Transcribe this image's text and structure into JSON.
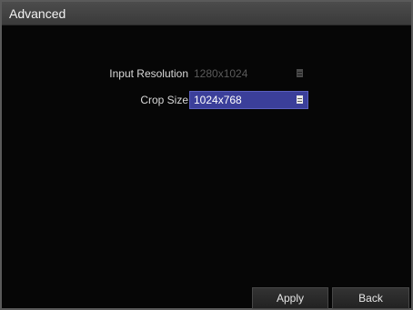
{
  "window": {
    "title": "Advanced"
  },
  "form": {
    "input_resolution": {
      "label": "Input Resolution",
      "value": "1280x1024",
      "enabled": false
    },
    "crop_size": {
      "label": "Crop Size",
      "value": "1024x768",
      "enabled": true
    }
  },
  "footer": {
    "apply_label": "Apply",
    "back_label": "Back"
  },
  "colors": {
    "accent": "#3b3f9a",
    "background": "#060606",
    "titlebar": "#444444"
  }
}
